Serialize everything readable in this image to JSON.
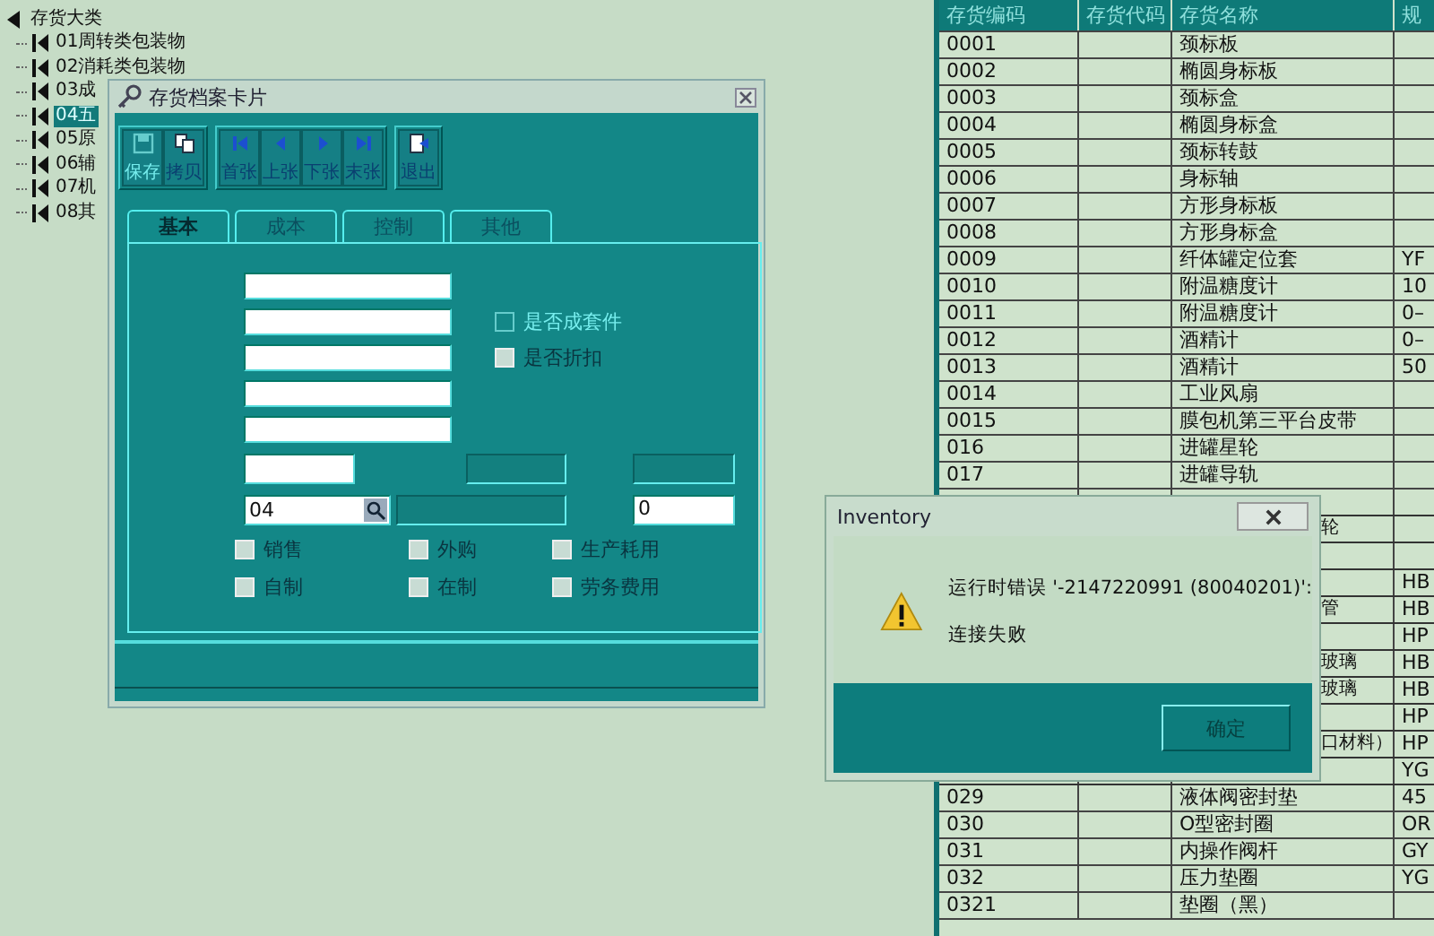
{
  "tree": {
    "root": "存货大类",
    "children": [
      {
        "label": "01周转类包装物",
        "selected": false
      },
      {
        "label": "02消耗类包装物",
        "selected": false
      },
      {
        "label": "03成",
        "selected": false
      },
      {
        "label": "04五",
        "selected": true
      },
      {
        "label": "05原",
        "selected": false
      },
      {
        "label": "06辅",
        "selected": false
      },
      {
        "label": "07机",
        "selected": false
      },
      {
        "label": "08其",
        "selected": false
      }
    ]
  },
  "card_window": {
    "title": "存货档案卡片",
    "toolbar": [
      [
        {
          "label": "保存",
          "kind": "save",
          "disabled": true
        },
        {
          "label": "拷贝",
          "kind": "copy",
          "disabled": false
        }
      ],
      [
        {
          "label": "首张",
          "kind": "first",
          "disabled": false
        },
        {
          "label": "上张",
          "kind": "prev",
          "disabled": false
        },
        {
          "label": "下张",
          "kind": "next",
          "disabled": false
        },
        {
          "label": "末张",
          "kind": "last",
          "disabled": false
        }
      ],
      [
        {
          "label": "退出",
          "kind": "exit",
          "disabled": false
        }
      ]
    ],
    "tabs": [
      {
        "label": "基本",
        "selected": true
      },
      {
        "label": "成本",
        "selected": false
      },
      {
        "label": "控制",
        "selected": false
      },
      {
        "label": "其他",
        "selected": false
      }
    ],
    "form_rows": [
      {
        "kind": "field",
        "items": [
          {
            "kind": "input",
            "disabled": false
          }
        ]
      },
      {
        "kind": "field",
        "items": [
          {
            "kind": "input",
            "disabled": false
          },
          {
            "kind": "checkbox",
            "label": "是否成套件",
            "checked": false,
            "disabled": true
          }
        ]
      },
      {
        "kind": "field",
        "items": [
          {
            "kind": "input",
            "disabled": false
          },
          {
            "kind": "checkbox",
            "label": "是否折扣",
            "checked": false,
            "disabled": false
          }
        ]
      },
      {
        "kind": "field",
        "items": [
          {
            "kind": "input",
            "disabled": false
          }
        ]
      },
      {
        "kind": "field",
        "items": [
          {
            "kind": "input",
            "disabled": false
          }
        ]
      },
      {
        "kind": "triple-a",
        "items": [
          {
            "kind": "input",
            "disabled": false
          },
          {
            "kind": "input",
            "disabled": true
          },
          {
            "kind": "input",
            "disabled": true
          }
        ]
      },
      {
        "kind": "triple-b",
        "items": [
          {
            "kind": "lookup",
            "value": "04",
            "disabled": false
          },
          {
            "kind": "input",
            "disabled": true
          },
          {
            "kind": "input",
            "value": "0",
            "disabled": false
          }
        ]
      },
      {
        "kind": "checks",
        "items": [
          {
            "kind": "checkbox",
            "label": "销售",
            "checked": false,
            "disabled": false
          },
          {
            "kind": "checkbox",
            "label": "外购",
            "checked": false,
            "disabled": false
          },
          {
            "kind": "checkbox",
            "label": "生产耗用",
            "checked": false,
            "disabled": false
          }
        ]
      },
      {
        "kind": "checks",
        "items": [
          {
            "kind": "checkbox",
            "label": "自制",
            "checked": false,
            "disabled": false
          },
          {
            "kind": "checkbox",
            "label": "在制",
            "checked": false,
            "disabled": false
          },
          {
            "kind": "checkbox",
            "label": "劳务费用",
            "checked": false,
            "disabled": false
          }
        ]
      }
    ]
  },
  "table": {
    "columns": [
      "存货编码",
      "存货代码",
      "存货名称",
      "规"
    ],
    "rows": [
      {
        "code": "0001",
        "name": "颈标板"
      },
      {
        "code": "0002",
        "name": "椭圆身标板"
      },
      {
        "code": "0003",
        "name": "颈标盒"
      },
      {
        "code": "0004",
        "name": "椭圆身标盒"
      },
      {
        "code": "0005",
        "name": "颈标转鼓"
      },
      {
        "code": "0006",
        "name": "身标轴"
      },
      {
        "code": "0007",
        "name": "方形身标板"
      },
      {
        "code": "0008",
        "name": "方形身标盒"
      },
      {
        "code": "0009",
        "name": "纤体罐定位套",
        "spec": "YF"
      },
      {
        "code": "0010",
        "name": "附温糖度计",
        "spec": "10"
      },
      {
        "code": "0011",
        "name": "附温糖度计",
        "spec": "0–"
      },
      {
        "code": "0012",
        "name": "酒精计",
        "spec": "0–"
      },
      {
        "code": "0013",
        "name": "酒精计",
        "spec": "50"
      },
      {
        "code": "0014",
        "name": "工业风扇"
      },
      {
        "code": "0015",
        "name": "膜包机第三平台皮带"
      },
      {
        "code": "016",
        "name": "进罐星轮"
      },
      {
        "code": "017",
        "name": "进罐导轨"
      },
      {
        "covered": true
      },
      {
        "covered": true,
        "name": "轮"
      },
      {
        "covered": true
      },
      {
        "covered": true,
        "spec": "HB"
      },
      {
        "covered": true,
        "name": "管",
        "spec": "HB"
      },
      {
        "covered": true,
        "spec": "HP"
      },
      {
        "covered": true,
        "name": "玻璃",
        "spec": "HB"
      },
      {
        "covered": true,
        "name": "玻璃",
        "spec": "HB"
      },
      {
        "covered": true,
        "spec": "HP"
      },
      {
        "covered": true,
        "name": "口材料）",
        "spec": "HP"
      },
      {
        "covered": true,
        "spec": "YG"
      },
      {
        "code": "029",
        "name": "液体阀密封垫",
        "spec": "45"
      },
      {
        "code": "030",
        "name": "O型密封圈",
        "spec": "OR"
      },
      {
        "code": "031",
        "name": "内操作阀杆",
        "spec": "GY"
      },
      {
        "code": "032",
        "name": "压力垫圈",
        "spec": "YG"
      },
      {
        "code": "0321",
        "name": "垫圈（黑）"
      }
    ]
  },
  "dialog": {
    "title": "Inventory",
    "message": "运行时错误 '-2147220991 (80040201)':",
    "detail": "连接失败",
    "button": "确定"
  }
}
